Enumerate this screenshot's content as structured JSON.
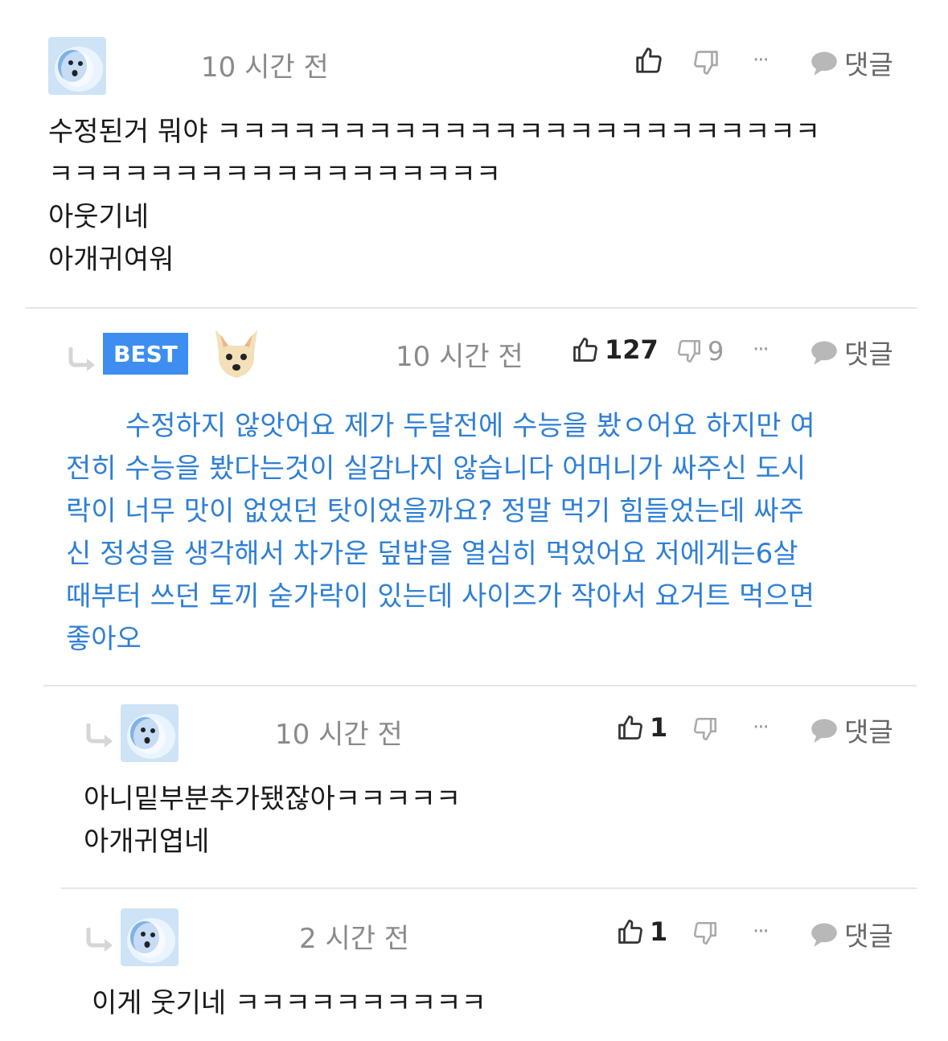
{
  "labels": {
    "reply": "댓글",
    "more": "···"
  },
  "comments": [
    {
      "time": "10 시간 전",
      "lines": [
        "수정된거 뭐야 ㅋㅋㅋㅋㅋㅋㅋㅋㅋㅋㅋㅋㅋㅋㅋㅋㅋㅋㅋㅋㅋㅋㅋㅋ",
        "ㅋㅋㅋㅋㅋㅋㅋㅋㅋㅋㅋㅋㅋㅋㅋㅋㅋㅋ",
        "아웃기네",
        "아개귀여워"
      ]
    },
    {
      "badge": "BEST",
      "time": "10 시간 전",
      "likes": "127",
      "dislikes": "9",
      "lines": [
        "수정하지 않앗어요 제가 두달전에 수능을 봤ㅇ어요 하지만 여",
        "전히 수능을 봤다는것이 실감나지 않습니다 어머니가 싸주신 도시",
        "락이 너무 맛이 없었던 탓이었을까요? 정말 먹기 힘들었는데 싸주",
        "신 정성을 생각해서 차가운 덮밥을 열심히 먹었어요 저에게는6살",
        "때부터 쓰던 토끼 숟가락이 있는데 사이즈가 작아서 요거트 먹으면",
        "좋아오"
      ]
    },
    {
      "time": "10 시간 전",
      "likes": "1",
      "lines": [
        "아니밑부분추가됐잖아ㅋㅋㅋㅋㅋ",
        "아개귀엽네"
      ]
    },
    {
      "time": "2 시간 전",
      "likes": "1",
      "lines": [
        "이게 웃기네 ㅋㅋㅋㅋㅋㅋㅋㅋㅋㅋ"
      ]
    }
  ],
  "colors": {
    "best_badge": "#3d8ef0",
    "best_text": "#2e7fd6",
    "meta_gray": "#8a8a8a"
  }
}
